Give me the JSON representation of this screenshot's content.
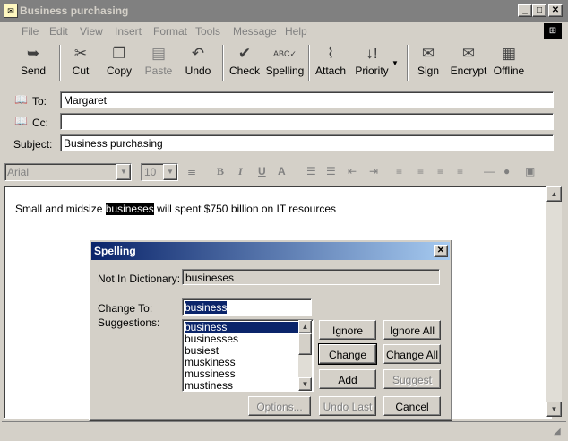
{
  "window": {
    "title": "Business purchasing"
  },
  "menu": [
    "File",
    "Edit",
    "View",
    "Insert",
    "Format",
    "Tools",
    "Message",
    "Help"
  ],
  "toolbar": {
    "send": "Send",
    "cut": "Cut",
    "copy": "Copy",
    "paste": "Paste",
    "undo": "Undo",
    "check": "Check",
    "spelling": "Spelling",
    "attach": "Attach",
    "priority": "Priority",
    "sign": "Sign",
    "encrypt": "Encrypt",
    "offline": "Offline"
  },
  "header": {
    "to_label": "To:",
    "to_value": "Margaret",
    "cc_label": "Cc:",
    "cc_value": "",
    "subject_label": "Subject:",
    "subject_value": "Business purchasing"
  },
  "format": {
    "font": "Arial",
    "size": "10"
  },
  "body": {
    "text_before": "Small and midsize ",
    "highlighted": "busineses",
    "text_after": " will spent $750 billion on IT resources"
  },
  "dialog": {
    "title": "Spelling",
    "not_in_dict_label": "Not In Dictionary:",
    "not_in_dict_value": "busineses",
    "change_to_label": "Change To:",
    "change_to_value": "business",
    "suggestions_label": "Suggestions:",
    "suggestions": [
      "business",
      "businesses",
      "busiest",
      "muskiness",
      "mussiness",
      "mustiness"
    ],
    "buttons": {
      "ignore": "Ignore",
      "ignore_all": "Ignore All",
      "change": "Change",
      "change_all": "Change All",
      "add": "Add",
      "suggest": "Suggest",
      "options": "Options...",
      "undo_last": "Undo Last",
      "cancel": "Cancel"
    }
  }
}
